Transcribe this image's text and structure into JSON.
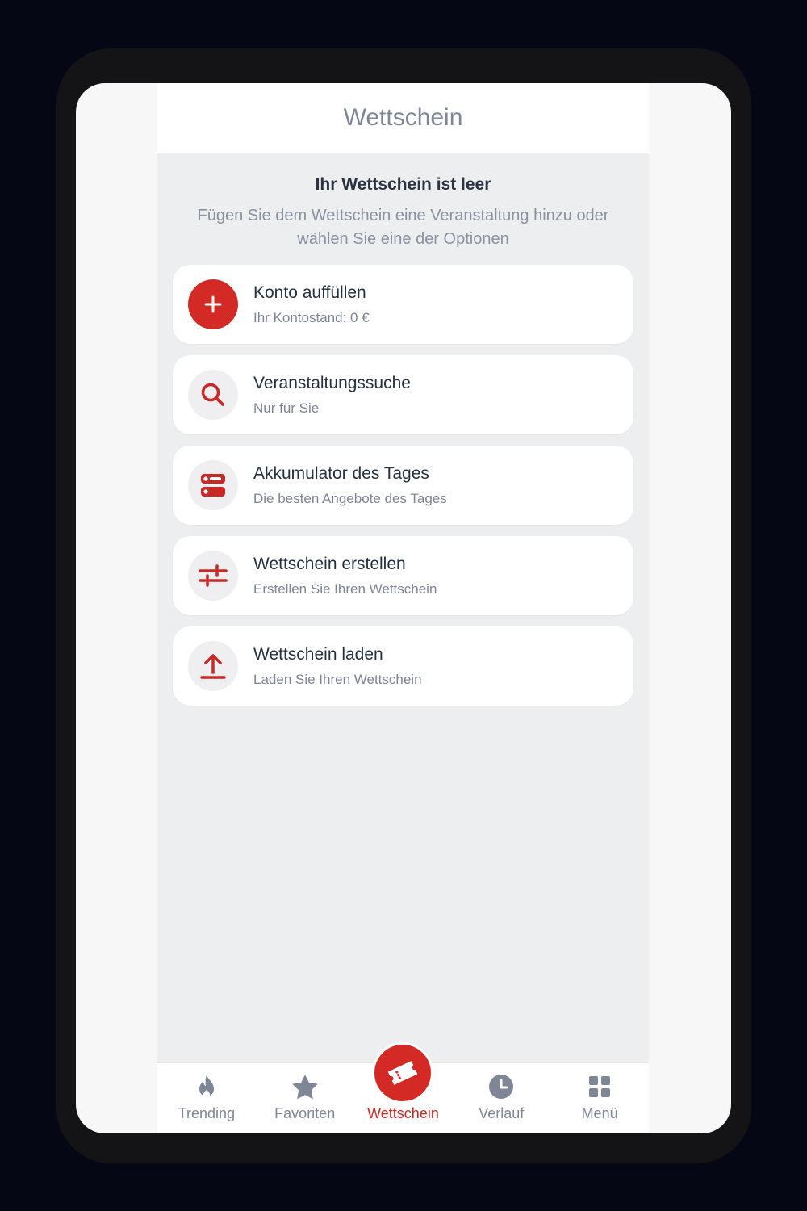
{
  "header": {
    "title": "Wettschein"
  },
  "empty_state": {
    "title": "Ihr Wettschein ist leer",
    "subtitle": "Fügen Sie dem Wettschein eine Veranstaltung hinzu oder wählen Sie eine der Optionen"
  },
  "options": [
    {
      "icon": "plus-icon",
      "title": "Konto auffüllen",
      "subtitle": "Ihr Kontostand: 0 €"
    },
    {
      "icon": "search-icon",
      "title": "Veranstaltungssuche",
      "subtitle": "Nur für Sie"
    },
    {
      "icon": "accumulator-icon",
      "title": "Akkumulator des Tages",
      "subtitle": "Die besten Angebote des Tages"
    },
    {
      "icon": "sliders-icon",
      "title": "Wettschein erstellen",
      "subtitle": "Erstellen Sie Ihren Wettschein"
    },
    {
      "icon": "upload-icon",
      "title": "Wettschein laden",
      "subtitle": "Laden Sie Ihren Wettschein"
    }
  ],
  "bottom_nav": [
    {
      "icon": "flame-icon",
      "label": "Trending"
    },
    {
      "icon": "star-icon",
      "label": "Favoriten"
    },
    {
      "icon": "ticket-icon",
      "label": "Wettschein",
      "active": true
    },
    {
      "icon": "clock-icon",
      "label": "Verlauf"
    },
    {
      "icon": "grid-icon",
      "label": "Menü"
    }
  ],
  "colors": {
    "accent": "#d42a26",
    "background": "#edeef0",
    "text_primary": "#253041",
    "text_secondary": "#7c8494"
  }
}
